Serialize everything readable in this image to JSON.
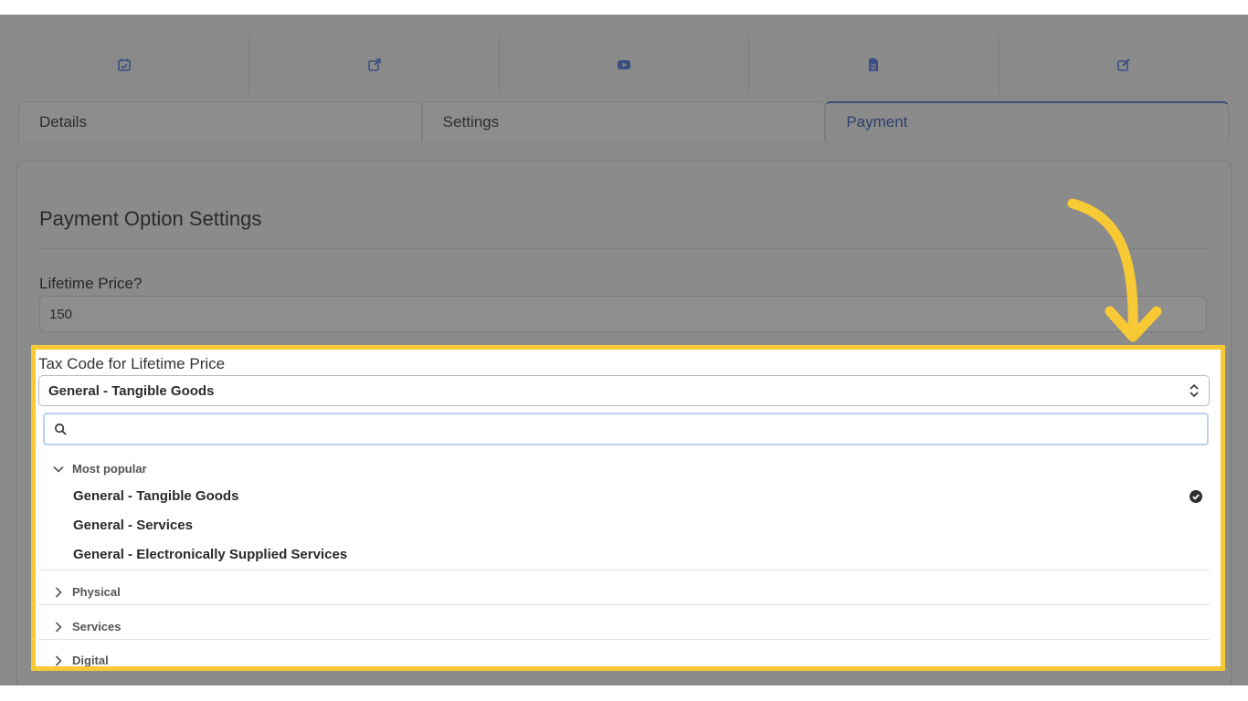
{
  "icon_bar": [
    {
      "icon": "calendar-check-icon"
    },
    {
      "icon": "external-link-icon"
    },
    {
      "icon": "video-play-icon"
    },
    {
      "icon": "document-icon"
    },
    {
      "icon": "edit-icon"
    }
  ],
  "tabs": [
    {
      "label": "Details"
    },
    {
      "label": "Settings"
    },
    {
      "label": "Payment"
    }
  ],
  "payment": {
    "section_title": "Payment Option Settings",
    "lifetime_price_label": "Lifetime Price?",
    "lifetime_price_value": "150",
    "tax_code_label": "Tax Code for Lifetime Price",
    "tax_code_selected": "General - Tangible Goods",
    "search_value": ""
  },
  "dropdown": {
    "groups": [
      {
        "label": "Most popular",
        "expanded": true,
        "options": [
          {
            "label": "General - Tangible Goods",
            "selected": true
          },
          {
            "label": "General - Services",
            "selected": false
          },
          {
            "label": "General - Electronically Supplied Services",
            "selected": false
          }
        ]
      },
      {
        "label": "Physical",
        "expanded": false
      },
      {
        "label": "Services",
        "expanded": false
      },
      {
        "label": "Digital",
        "expanded": false
      }
    ]
  },
  "colors": {
    "highlight": "#f7c935",
    "overlay": "#8a8a8a",
    "icon": "#3b4d83"
  }
}
